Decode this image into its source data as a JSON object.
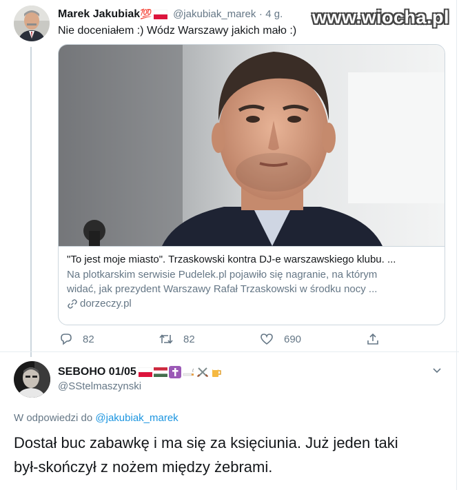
{
  "watermark": "www.wiocha.pl",
  "tweet1": {
    "author_name": "Marek Jakubiak",
    "author_emoji": "💯",
    "handle": "@jakubiak_marek",
    "separator": "·",
    "time": "4 g.",
    "text": "Nie doceniałem :)  Wódz Warszawy jakich mało :)",
    "card": {
      "title": "\"To jest moje miasto\". Trzaskowski kontra DJ-e warszawskiego klubu. ...",
      "description_line1": "Na plotkarskim serwisie Pudelek.pl pojawiło się nagranie, na którym",
      "description_line2": "widać, jak prezydent Warszawy Rafał Trzaskowski w środku nocy ...",
      "domain": "dorzeczy.pl"
    },
    "actions": {
      "replies": "82",
      "retweets": "82",
      "likes": "690"
    }
  },
  "tweet2": {
    "author_name": "SEBOHO 01/05",
    "handle": "@SStelmaszynski",
    "reply_prefix": "W odpowiedzi do",
    "reply_to": "@jakubiak_marek",
    "text_line1": "Dostał buc zabawkę i ma się za księciunia. Już jeden taki",
    "text_line2": "był-skończył z nożem między żebrami."
  },
  "colors": {
    "link": "#1b95e0",
    "muted": "#657786",
    "border": "#ccd6dd"
  }
}
